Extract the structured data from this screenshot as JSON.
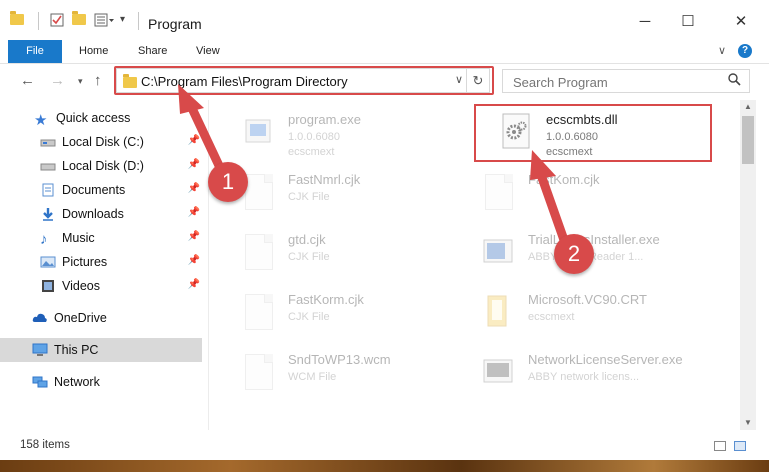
{
  "window": {
    "title": "Program",
    "minimize_glyph": "─",
    "maximize_glyph": "☐",
    "close_glyph": "✕"
  },
  "ribbon": {
    "tabs": [
      "File",
      "Home",
      "Share",
      "View"
    ],
    "expand_glyph": "∨",
    "help_glyph": "?"
  },
  "address": {
    "path": "C:\\Program Files\\Program Directory",
    "search_placeholder": "Search Program"
  },
  "sidebar": {
    "items": [
      {
        "label": "Quick access",
        "icon": "star-icon"
      },
      {
        "label": "Local Disk (C:)",
        "icon": "drive-icon"
      },
      {
        "label": "Local Disk (D:)",
        "icon": "drive-icon"
      },
      {
        "label": "Documents",
        "icon": "documents-icon"
      },
      {
        "label": "Downloads",
        "icon": "downloads-icon"
      },
      {
        "label": "Music",
        "icon": "music-icon"
      },
      {
        "label": "Pictures",
        "icon": "pictures-icon"
      },
      {
        "label": "Videos",
        "icon": "videos-icon"
      },
      {
        "label": "OneDrive",
        "icon": "cloud-icon"
      },
      {
        "label": "This PC",
        "icon": "computer-icon"
      },
      {
        "label": "Network",
        "icon": "network-icon"
      }
    ]
  },
  "files": [
    {
      "name": "program.exe",
      "line1": "1.0.0.6080",
      "line2": "ecscmext"
    },
    {
      "name": "ecscmbts.dll",
      "line1": "1.0.0.6080",
      "line2": "ecscmext"
    },
    {
      "name": "FastNmrl.cjk",
      "line1": "CJK File",
      "line2": ""
    },
    {
      "name": "FastKom.cjk",
      "line1": "",
      "line2": ""
    },
    {
      "name": "gtd.cjk",
      "line1": "CJK File",
      "line2": ""
    },
    {
      "name": "TrialLicensInstaller.exe",
      "line1": "ABBYY FineReader 1...",
      "line2": ""
    },
    {
      "name": "FastKorm.cjk",
      "line1": "CJK File",
      "line2": ""
    },
    {
      "name": "Microsoft.VC90.CRT",
      "line1": "ecscmext",
      "line2": ""
    },
    {
      "name": "SndToWP13.wcm",
      "line1": "WCM File",
      "line2": ""
    },
    {
      "name": "NetworkLicenseServer.exe",
      "line1": "ABBY network licens...",
      "line2": ""
    }
  ],
  "status": {
    "item_count": "158 items"
  },
  "annotations": [
    "1",
    "2"
  ],
  "colors": {
    "accent": "#1979ca",
    "highlight": "#d84a4a"
  }
}
